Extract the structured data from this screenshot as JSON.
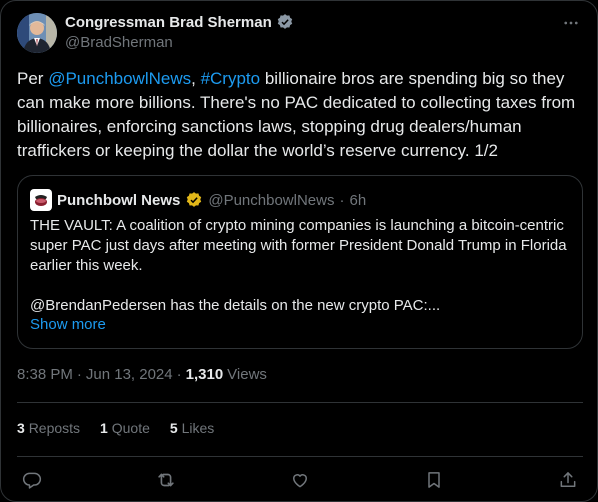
{
  "author": {
    "display_name": "Congressman Brad Sherman",
    "handle": "@BradSherman"
  },
  "tweet": {
    "text_parts": {
      "p1": "Per ",
      "link1": "@PunchbowlNews",
      "p2": ", ",
      "link2": "#Crypto",
      "p3": " billionaire bros are spending big so they can make more billions. There's no PAC dedicated to collecting taxes from billionaires, enforcing sanctions laws, stopping drug dealers/human traffickers or keeping the dollar the world’s reserve currency. 1/2"
    }
  },
  "quote": {
    "name": "Punchbowl News",
    "handle": "@PunchbowlNews",
    "separator": "·",
    "time": "6h",
    "text": "THE VAULT: A coalition of crypto mining companies is launching a bitcoin-centric super PAC just days after meeting with former President Donald Trump in Florida earlier this week.\n\n@BrendanPedersen has the details on the new crypto PAC:...",
    "show_more": "Show more"
  },
  "meta": {
    "time": "8:38 PM",
    "sep1": "·",
    "date": "Jun 13, 2024",
    "sep2": "·",
    "views_count": "1,310",
    "views_label": "Views"
  },
  "stats": {
    "reposts_count": "3",
    "reposts_label": "Reposts",
    "quotes_count": "1",
    "quotes_label": "Quote",
    "likes_count": "5",
    "likes_label": "Likes"
  },
  "icons": {
    "verified": "verified-badge-icon",
    "gold_verified": "gold-verified-badge-icon",
    "more": "more-icon",
    "reply": "reply-icon",
    "repost": "repost-icon",
    "like": "like-icon",
    "bookmark": "bookmark-icon",
    "share": "share-icon"
  },
  "colors": {
    "background": "#000000",
    "text": "#e7e9ea",
    "secondary": "#71767b",
    "link": "#1d9bf0",
    "border": "#2f3336",
    "gold": "#e2b719"
  }
}
